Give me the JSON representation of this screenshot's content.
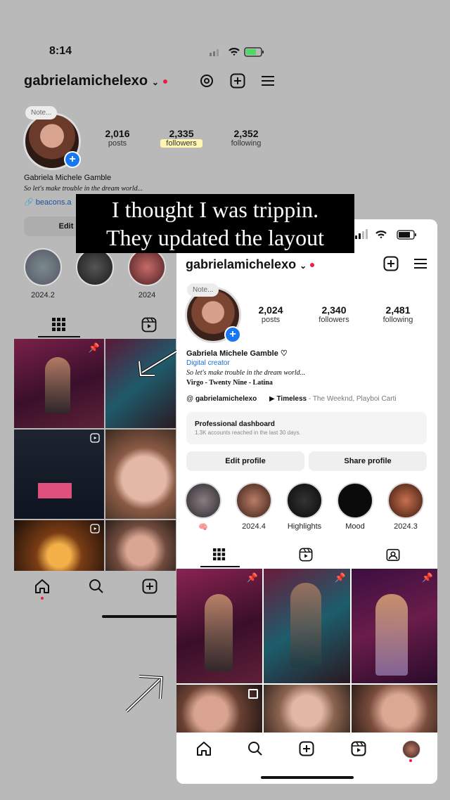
{
  "back": {
    "status": {
      "time": "8:14"
    },
    "username": "gabrielamichelexo",
    "note": "Note...",
    "stats": [
      {
        "value": "2,016",
        "label": "posts"
      },
      {
        "value": "2,335",
        "label": "followers"
      },
      {
        "value": "2,352",
        "label": "following"
      }
    ],
    "name": "Gabriela Michele Gamble",
    "bio": "So let's make trouble in the dream world...",
    "link": "beacons.a",
    "edit_label": "Edit",
    "highlights": [
      {
        "label": "2024.2"
      },
      {
        "label": ""
      },
      {
        "label": "2024"
      }
    ]
  },
  "caption": {
    "line1": "I thought I was trippin.",
    "line2": "They updated the layout"
  },
  "front": {
    "username": "gabrielamichelexo",
    "note": "Note...",
    "stats": [
      {
        "value": "2,024",
        "label": "posts"
      },
      {
        "value": "2,340",
        "label": "followers"
      },
      {
        "value": "2,481",
        "label": "following"
      }
    ],
    "name": "Gabriela Michele Gamble ♡",
    "category": "Digital creator",
    "bio": "So let's make trouble in the dream world...",
    "bio2": "Virgo - Twenty Nine - Latina",
    "threads_handle": "gabrielamichelexo",
    "music_title": "Timeless",
    "music_artist": " - The Weeknd, Playboi Carti",
    "dashboard_title": "Professional dashboard",
    "dashboard_sub": "1.3K accounts reached in the last 30 days.",
    "edit_profile": "Edit profile",
    "share_profile": "Share profile",
    "highlights": [
      {
        "label": "🧠"
      },
      {
        "label": "2024.4"
      },
      {
        "label": "Highlights"
      },
      {
        "label": "Mood"
      },
      {
        "label": "2024.3"
      }
    ]
  },
  "colors": {
    "accent": "#1877f2",
    "dot": "#ed1c45",
    "background": "#b9b9b9"
  }
}
